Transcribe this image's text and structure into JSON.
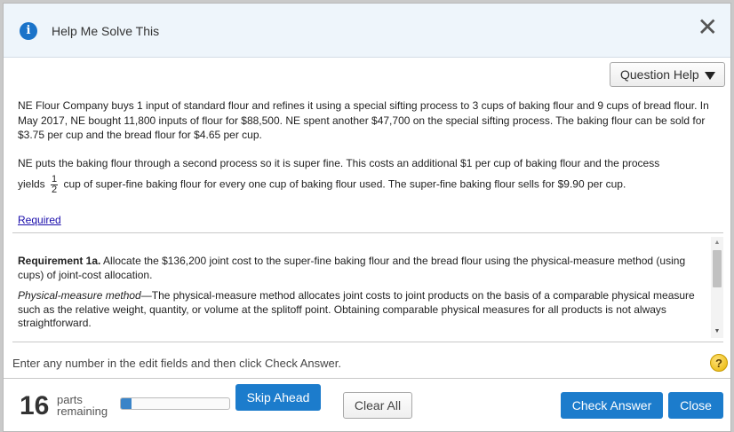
{
  "dialog": {
    "title": "Help Me Solve This",
    "close_glyph": "✕",
    "question_help_label": "Question Help"
  },
  "problem": {
    "paragraph1": "NE Flour Company buys 1 input of standard flour and refines it using a special sifting process to 3 cups of baking flour and 9 cups of bread flour. In May 2017, NE bought 11,800 inputs of flour for $88,500. NE spent another $47,700 on the special sifting process. The baking flour can be sold for $3.75 per cup and the bread flour for $4.65 per cup.",
    "paragraph2": "NE puts the baking flour through a second process so it is super fine. This costs an additional $1 per cup of baking flour and the process",
    "paragraph3_start": "yields",
    "fraction_num": "1",
    "fraction_den": "2",
    "paragraph3_end": "cup of super-fine baking flour for every one cup of baking flour used. The super-fine baking flour sells for $9.90 per cup.",
    "required_link": "Required"
  },
  "requirement": {
    "heading": "Requirement 1a.",
    "text": " Allocate the $136,200 joint cost to the super-fine baking flour and the bread flour using the physical-measure method (using cups) of joint-cost allocation.",
    "method_term": "Physical-measure method",
    "method_text": "—The physical-measure method allocates joint costs to joint products on the basis of a comparable physical measure such as the relative weight, quantity, or volume at the splitoff point. Obtaining comparable physical measures for all products is not always straightforward."
  },
  "footer": {
    "instruction": "Enter any number in the edit fields and then click Check Answer.",
    "help_glyph": "?",
    "parts_count": "16",
    "parts_label_1": "parts",
    "parts_label_2": "remaining",
    "progress_fraction": 0.1,
    "skip_label": "Skip Ahead",
    "clear_label": "Clear All",
    "check_label": "Check Answer",
    "close_label": "Close"
  },
  "colors": {
    "primary_button": "#1c7ccc",
    "title_bar": "#eef5fb",
    "link": "#1a0dab"
  }
}
